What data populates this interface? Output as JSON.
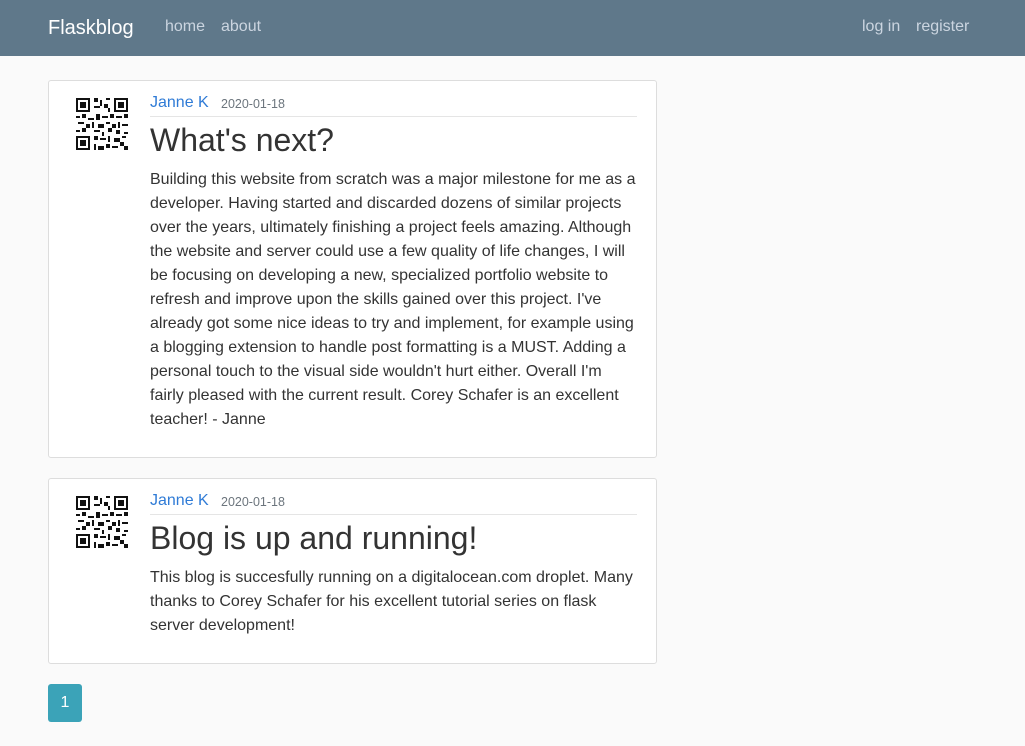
{
  "navbar": {
    "brand": "Flaskblog",
    "left_links": [
      "home",
      "about"
    ],
    "right_links": [
      "log in",
      "register"
    ],
    "background": "#5f788a"
  },
  "posts": [
    {
      "author": "Janne K",
      "date": "2020-01-18",
      "title": "What's next?",
      "lines": [
        "Building this website from scratch was a major milestone for me as a",
        "developer. Having started and discarded dozens of similar projects",
        "over the years, ultimately finishing a project feels amazing. Although",
        "the website and server could use a few quality of life changes, I will",
        "be focusing on developing a new, specialized portfolio website to",
        "refresh and improve upon the skills gained over this project. I've",
        "already got some nice ideas to try and implement, for example using",
        "a blogging extension to handle post formatting is a MUST. Adding a",
        "personal touch to the visual side wouldn't hurt either. Overall I'm",
        "fairly pleased with the current result. Corey Schafer is an excellent",
        "teacher! - Janne"
      ]
    },
    {
      "author": "Janne K",
      "date": "2020-01-18",
      "title": "Blog is up and running!",
      "lines": [
        "This blog is succesfully running on a digitalocean.com droplet. Many",
        "thanks to Corey Schafer for his excellent tutorial series on flask",
        "server development!"
      ]
    }
  ],
  "pagination": {
    "current_page": "1",
    "accent": "#3ba3b8"
  },
  "icons": {
    "avatar": "qr-code-icon"
  }
}
